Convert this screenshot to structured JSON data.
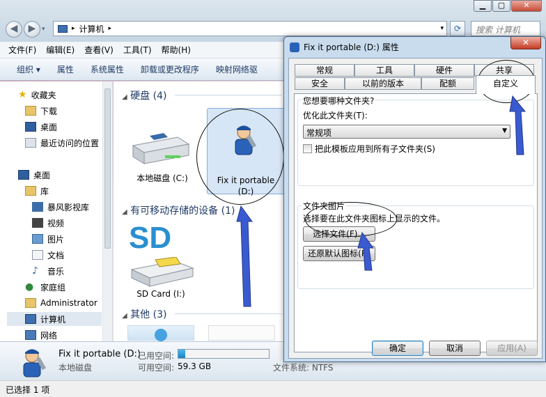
{
  "explorer": {
    "address": {
      "path_label": "计算机"
    },
    "search_placeholder": "搜索 计算机",
    "window_buttons": {
      "minimize": "▁",
      "maximize": "▢",
      "close": "✕"
    },
    "menu": [
      "文件(F)",
      "编辑(E)",
      "查看(V)",
      "工具(T)",
      "帮助(H)"
    ],
    "toolbar": [
      "组织 ▾",
      "属性",
      "系统属性",
      "卸载或更改程序",
      "映射网络驱"
    ],
    "nav": {
      "favorites": "收藏夹",
      "favorite_items": [
        "下载",
        "桌面",
        "最近访问的位置"
      ],
      "desktop": "桌面",
      "libraries": "库",
      "library_items": [
        "暴风影视库",
        "视频",
        "图片",
        "文档",
        "音乐"
      ],
      "homegroup": "家庭组",
      "user": "Administrator",
      "computer": "计算机",
      "network": "网络"
    },
    "groups": {
      "hard_disks": "硬盘 (4)",
      "removable": "有可移动存储的设备 (1)",
      "other": "其他 (3)"
    },
    "drives": {
      "local_c": "本地磁盘 (C:)",
      "fixit_line1": "Fix it portable",
      "fixit_line2": "(D:)",
      "sd_label": "SD",
      "sd_card": "SD Card (I:)"
    },
    "details": {
      "name": "Fix it portable (D:)",
      "type": "本地磁盘",
      "used_label": "已用空间:",
      "used_fraction": 0.08,
      "free_label": "可用空间:",
      "free_value": "59.3 GB",
      "fs_label": "文件系统: NTFS"
    },
    "status": "已选择 1 项"
  },
  "dialog": {
    "title": "Fix it portable (D:) 属性",
    "close": "✕",
    "tabs_row1": [
      "常规",
      "工具",
      "硬件",
      "共享"
    ],
    "tabs_row2": [
      "安全",
      "以前的版本",
      "配额",
      "自定义"
    ],
    "folder_type": {
      "question": "您想要哪种文件夹?",
      "optimize_label": "优化此文件夹(T):",
      "selected": "常规项",
      "apply_all": "把此模板应用到所有子文件夹(S)"
    },
    "folder_picture": {
      "title": "文件夹图片",
      "desc": "选择要在此文件夹图标上显示的文件。",
      "choose_file": "选择文件(F)...",
      "restore_default": "还原默认图标(R)"
    },
    "buttons": {
      "ok": "确定",
      "cancel": "取消",
      "apply": "应用(A)"
    }
  },
  "colors": {
    "accent": "#1e3a66",
    "annotation_arrow": "#3a5bd0"
  }
}
